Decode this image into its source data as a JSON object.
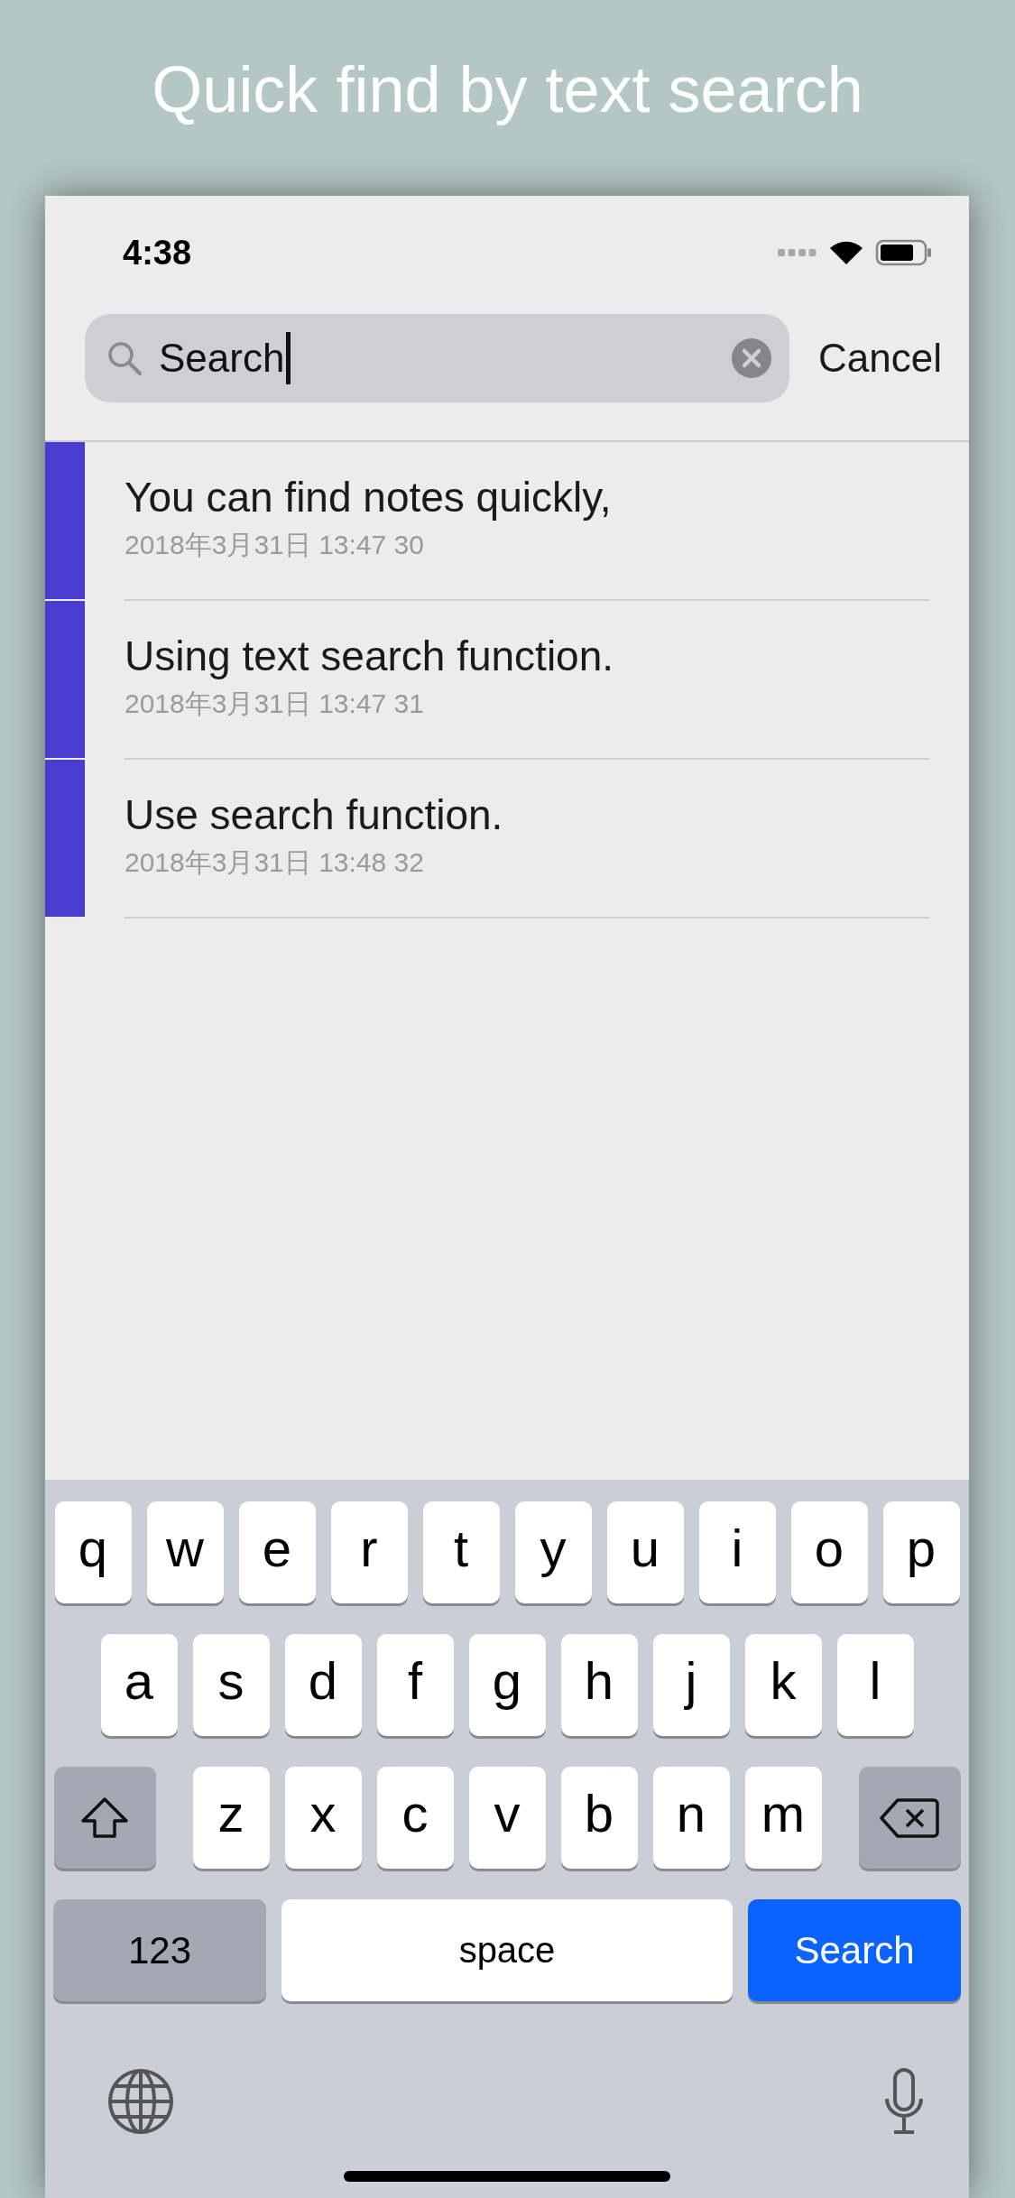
{
  "headline": "Quick find by text search",
  "status_bar": {
    "time": "4:38"
  },
  "search": {
    "value": "Search",
    "cancel": "Cancel"
  },
  "notes": [
    {
      "title": "You can find notes quickly,",
      "date": "2018年3月31日 13:47 30",
      "color": "#4a3ccf"
    },
    {
      "title": "Using text search function.",
      "date": "2018年3月31日 13:47 31",
      "color": "#4a3ccf"
    },
    {
      "title": "Use search function.",
      "date": "2018年3月31日 13:48 32",
      "color": "#4a3ccf"
    }
  ],
  "keyboard": {
    "letter_rows": [
      [
        "q",
        "w",
        "e",
        "r",
        "t",
        "y",
        "u",
        "i",
        "o",
        "p"
      ],
      [
        "a",
        "s",
        "d",
        "f",
        "g",
        "h",
        "j",
        "k",
        "l"
      ],
      [
        "z",
        "x",
        "c",
        "v",
        "b",
        "n",
        "m"
      ]
    ],
    "numbers_key": "123",
    "space_key": "space",
    "search_key": "Search"
  }
}
